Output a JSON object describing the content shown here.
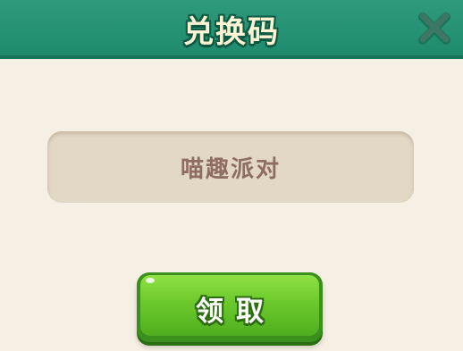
{
  "dialog": {
    "title": "兑换码",
    "close_icon": "close-x-icon",
    "code_value": "喵趣派对",
    "claim_label": "领取"
  },
  "colors": {
    "header": "#2f9a7c",
    "background": "#f6f0e4",
    "input": "#e3d7c6",
    "button": "#6cc92c",
    "title_text": "#fbf3d3",
    "input_text": "#8e6e63"
  }
}
